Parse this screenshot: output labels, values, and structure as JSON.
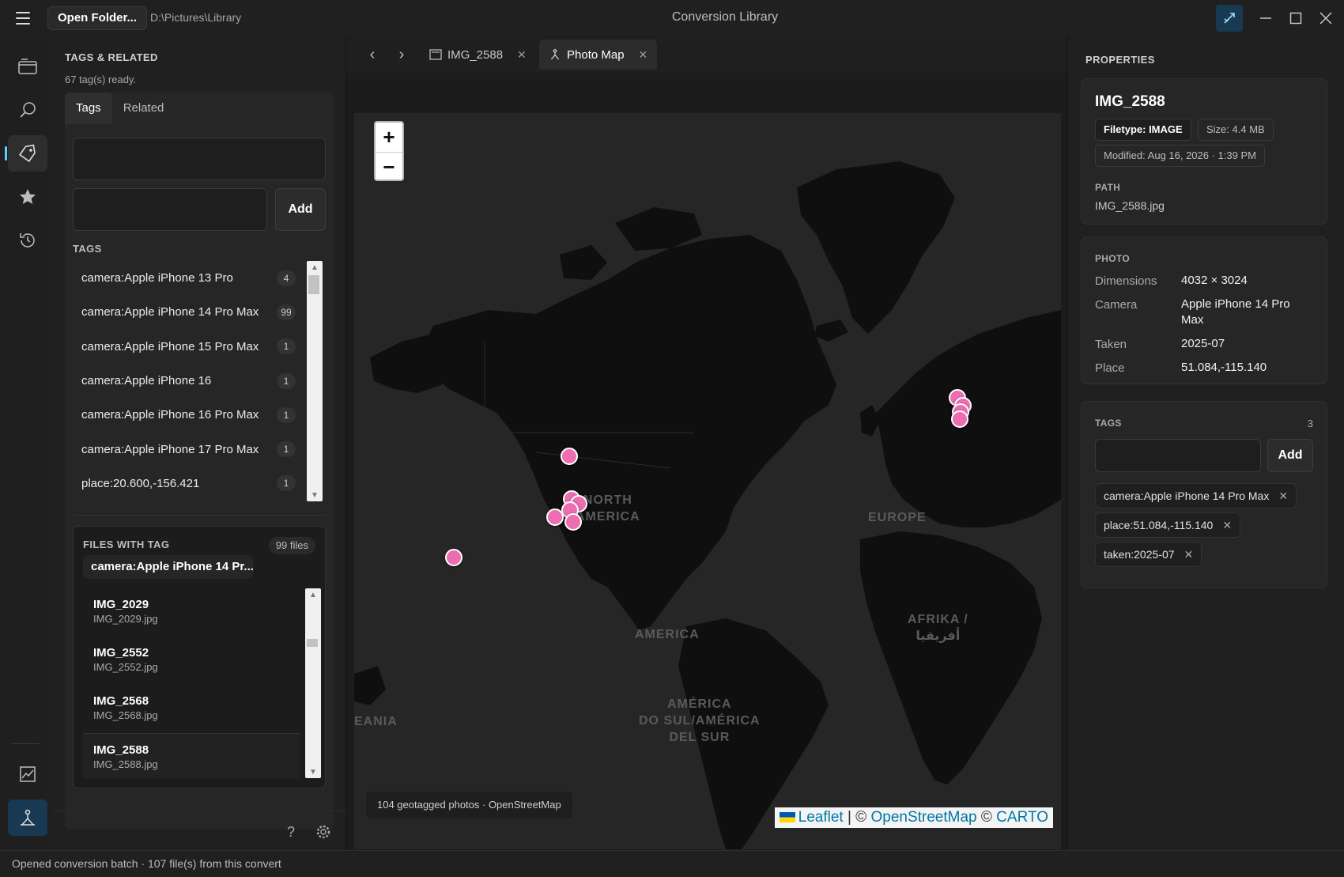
{
  "window": {
    "title": "Conversion Library",
    "open_folder_label": "Open Folder...",
    "current_path": "D:\\Pictures\\Library"
  },
  "rail": {
    "items": [
      "folder-icon",
      "search-icon",
      "tag-icon",
      "star-icon",
      "history-icon",
      "image-chart-icon",
      "map-person-icon"
    ],
    "active": "tag-icon",
    "accent_color": "#60cdff"
  },
  "tags_panel": {
    "heading": "TAGS & RELATED",
    "status": "67 tag(s) ready.",
    "tabs": [
      {
        "label": "Tags",
        "active": true
      },
      {
        "label": "Related",
        "active": false
      }
    ],
    "search_placeholder": "",
    "new_tag_value": "",
    "add_label": "Add",
    "tags_label": "TAGS",
    "tags": [
      {
        "name": "camera:Apple iPhone 13 Pro",
        "count": "4"
      },
      {
        "name": "camera:Apple iPhone 14 Pro Max",
        "count": "99"
      },
      {
        "name": "camera:Apple iPhone 15 Pro Max",
        "count": "1"
      },
      {
        "name": "camera:Apple iPhone 16",
        "count": "1"
      },
      {
        "name": "camera:Apple iPhone 16 Pro Max",
        "count": "1"
      },
      {
        "name": "camera:Apple iPhone 17 Pro Max",
        "count": "1"
      },
      {
        "name": "place:20.600,-156.421",
        "count": "1"
      }
    ],
    "files_with_tag": {
      "label": "FILES WITH TAG",
      "count": "99 files",
      "selected_tag": "camera:Apple iPhone 14 Pr...",
      "files": [
        {
          "title": "IMG_2029",
          "file": "IMG_2029.jpg",
          "selected": false
        },
        {
          "title": "IMG_2552",
          "file": "IMG_2552.jpg",
          "selected": false
        },
        {
          "title": "IMG_2568",
          "file": "IMG_2568.jpg",
          "selected": false
        },
        {
          "title": "IMG_2588",
          "file": "IMG_2588.jpg",
          "selected": true
        }
      ]
    }
  },
  "tabs": [
    {
      "label": "IMG_2588",
      "icon": "image-icon",
      "active": false
    },
    {
      "label": "Photo Map",
      "icon": "map-person-icon",
      "active": true
    }
  ],
  "map": {
    "zoom_in": "+",
    "zoom_out": "−",
    "labels": {
      "north_america": "NORTH\nAMERICA",
      "europe": "EUROPE",
      "africa": "AFRIKA /\nأفريقيا",
      "central_america": "AMERICA",
      "south_america": "AMÉRICA\nDO SUL/AMÉRICA\nDEL SUR",
      "oceania": "EANIA"
    },
    "marker_color": "#ec6db0",
    "status": "104 geotagged photos · OpenStreetMap",
    "attribution": {
      "leaflet": "Leaflet",
      "sep1": " | © ",
      "osm": "OpenStreetMap",
      "sep2": " © ",
      "carto": "CARTO"
    }
  },
  "properties": {
    "heading": "PROPERTIES",
    "name": "IMG_2588",
    "filetype": "Filetype: IMAGE",
    "size": "Size: 4.4 MB",
    "modified": "Modified: Aug 16, 2026 · 1:39 PM",
    "path_label": "PATH",
    "path": "IMG_2588.jpg",
    "photo_label": "PHOTO",
    "photo": [
      {
        "key": "Dimensions",
        "value": "4032 × 3024"
      },
      {
        "key": "Camera",
        "value": "Apple iPhone 14 Pro Max"
      },
      {
        "key": "Taken",
        "value": "2025-07"
      },
      {
        "key": "Place",
        "value": "51.084,-115.140"
      }
    ],
    "tags_label": "TAGS",
    "tags_count": "3",
    "tag_input": "",
    "add_label": "Add",
    "tags": [
      "camera:Apple iPhone 14 Pro Max",
      "place:51.084,-115.140",
      "taken:2025-07"
    ]
  },
  "statusbar": {
    "text": "Opened conversion batch · 107 file(s) from this convert"
  }
}
